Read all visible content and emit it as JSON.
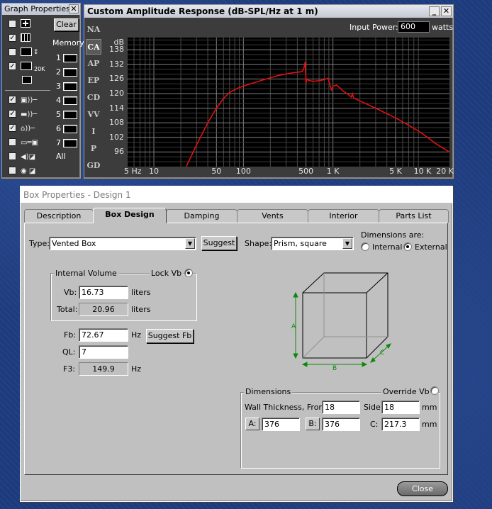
{
  "graph_properties": {
    "title": "Graph Properties",
    "close_glyph": "✕",
    "clear_label": "Clear",
    "memory_label": "Memory",
    "memory_slots": [
      "1",
      "2",
      "3",
      "4",
      "5",
      "6",
      "7"
    ],
    "all_label": "All",
    "label_20k": "20K",
    "check_glyph": "✓",
    "checks": [
      false,
      true,
      false,
      true,
      null,
      true,
      true,
      true,
      false,
      false,
      false,
      false
    ]
  },
  "graph_window": {
    "title": "Custom Amplitude Response (dB-SPL/Hz at 1 m)",
    "input_power_label": "Input Power:",
    "input_power_value": "600",
    "watts_label": "watts",
    "vtabs": [
      "NA",
      "CA",
      "AP",
      "EP",
      "CD",
      "VV",
      "I",
      "P",
      "GD"
    ],
    "active_vtab": "CA",
    "minimize_glyph": "_",
    "close_glyph": "✕"
  },
  "chart_data": {
    "type": "line",
    "title": "Custom Amplitude Response (dB-SPL/Hz at 1 m)",
    "ylabel": "dB",
    "xlabel": "",
    "x_scale": "log",
    "xlim": [
      5,
      20000
    ],
    "ylim": [
      90,
      143
    ],
    "yticks": [
      96,
      102,
      108,
      114,
      120,
      126,
      132,
      138
    ],
    "xtick_labels": [
      "5 Hz",
      "10",
      "50",
      "100",
      "500",
      "1 K",
      "5 K",
      "10 K",
      "20 K"
    ],
    "xtick_values": [
      5,
      10,
      50,
      100,
      500,
      1000,
      5000,
      10000,
      20000
    ],
    "grid": true,
    "line_color": "#e01010",
    "series": [
      {
        "points": [
          [
            23,
            90
          ],
          [
            30,
            99
          ],
          [
            40,
            108
          ],
          [
            50,
            114
          ],
          [
            60,
            118
          ],
          [
            70,
            120.5
          ],
          [
            90,
            122.5
          ],
          [
            120,
            124
          ],
          [
            180,
            126
          ],
          [
            250,
            127.5
          ],
          [
            350,
            128.5
          ],
          [
            450,
            129
          ],
          [
            470,
            130
          ],
          [
            480,
            131.5
          ],
          [
            490,
            133
          ],
          [
            495,
            128
          ],
          [
            500,
            124
          ],
          [
            510,
            126
          ],
          [
            530,
            125.5
          ],
          [
            600,
            125
          ],
          [
            700,
            125.3
          ],
          [
            800,
            125.7
          ],
          [
            880,
            126.3
          ],
          [
            920,
            124
          ],
          [
            960,
            121.5
          ],
          [
            1000,
            123
          ],
          [
            1100,
            123.5
          ],
          [
            1300,
            121
          ],
          [
            1500,
            119.5
          ],
          [
            1600,
            118.5
          ],
          [
            1650,
            120
          ],
          [
            1700,
            118.2
          ],
          [
            2000,
            117
          ],
          [
            3000,
            114
          ],
          [
            5000,
            110
          ],
          [
            7000,
            107
          ],
          [
            10000,
            103.5
          ],
          [
            14000,
            99.5
          ],
          [
            20000,
            96
          ]
        ]
      }
    ]
  },
  "box_properties": {
    "title": "Box Properties - Design 1",
    "tabs": [
      "Description",
      "Box Design",
      "Damping",
      "Vents",
      "Interior",
      "Parts List"
    ],
    "active_tab": "Box Design",
    "type_label": "Type:",
    "type_value": "Vented Box",
    "suggest_label": "Suggest",
    "shape_label": "Shape:",
    "shape_value": "Prism, square",
    "dimensions_are_label": "Dimensions are:",
    "internal_label": "Internal",
    "external_label": "External",
    "dimensions_mode": "External",
    "internal_volume_label": "Internal Volume",
    "lock_vb_label": "Lock Vb",
    "vb_label": "Vb:",
    "vb_value": "16.73",
    "vb_unit": "liters",
    "total_label": "Total:",
    "total_value": "20.96",
    "total_unit": "liters",
    "fb_label": "Fb:",
    "fb_value": "72.67",
    "fb_unit": "Hz",
    "suggest_fb_label": "Suggest Fb",
    "ql_label": "QL:",
    "ql_value": "7",
    "f3_label": "F3:",
    "f3_value": "149.9",
    "f3_unit": "Hz",
    "diagram_labels": {
      "a": "A",
      "b": "B",
      "c": "C"
    },
    "dimensions_label": "Dimensions",
    "override_vb_label": "Override Vb",
    "wall_thickness_front_label": "Wall Thickness, Front:",
    "wall_front_value": "18",
    "side_label": "Side:",
    "side_value": "18",
    "mm1": "mm",
    "a_label": "A:",
    "a_value": "376",
    "b_label": "B:",
    "b_value": "376",
    "c_label": "C:",
    "c_value": "217.3",
    "mm2": "mm",
    "close_label": "Close"
  }
}
